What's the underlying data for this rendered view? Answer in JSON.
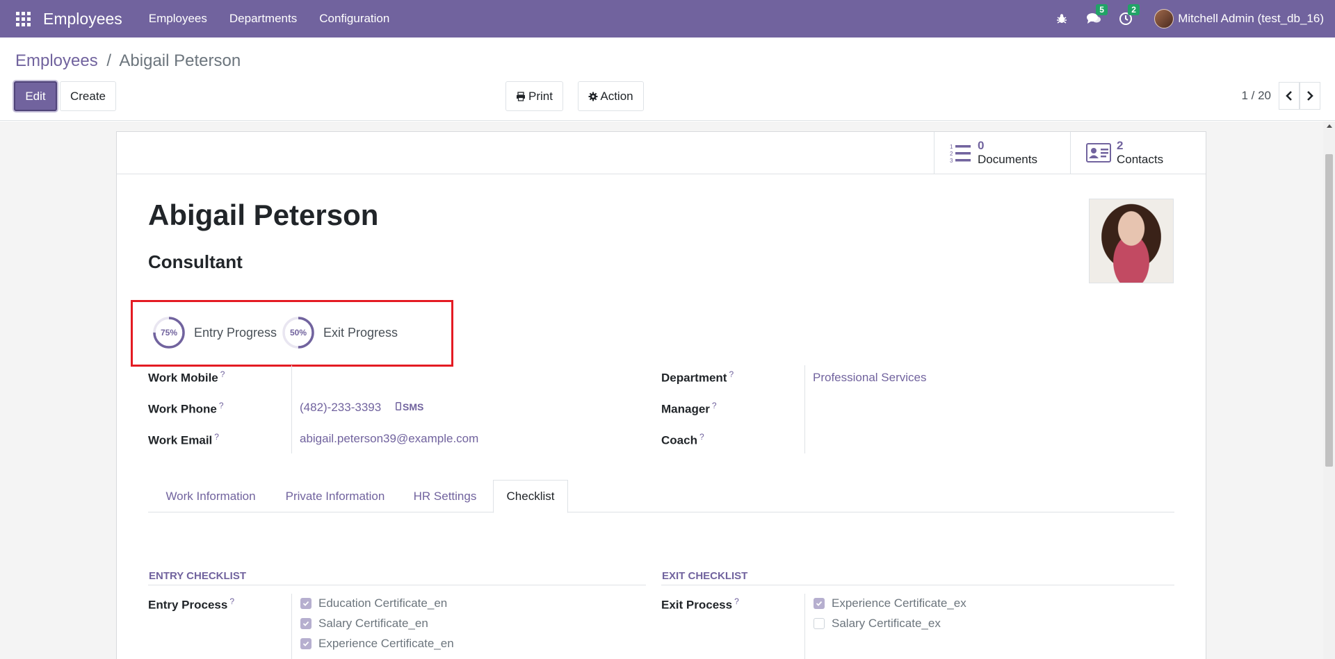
{
  "navbar": {
    "app_name": "Employees",
    "menu": [
      "Employees",
      "Departments",
      "Configuration"
    ],
    "messages_count": "5",
    "activities_count": "2",
    "user": "Mitchell Admin (test_db_16)"
  },
  "breadcrumb": {
    "parent": "Employees",
    "separator": "/",
    "current": "Abigail Peterson"
  },
  "toolbar": {
    "edit": "Edit",
    "create": "Create",
    "print": "Print",
    "action": "Action"
  },
  "pager": {
    "value": "1 / 20"
  },
  "smart_buttons": [
    {
      "count": "0",
      "label": "Documents",
      "icon": "list-numbered-icon"
    },
    {
      "count": "2",
      "label": "Contacts",
      "icon": "contact-card-icon"
    }
  ],
  "employee": {
    "name": "Abigail Peterson",
    "job_title": "Consultant"
  },
  "progress": [
    {
      "label": "Entry Progress",
      "percent_text": "75%",
      "value": 0.75
    },
    {
      "label": "Exit Progress",
      "percent_text": "50%",
      "value": 0.5
    }
  ],
  "fields_left": [
    {
      "label": "Work Mobile",
      "help": "?",
      "value": ""
    },
    {
      "label": "Work Phone",
      "help": "?",
      "value": "(482)-233-3393",
      "extra": "SMS"
    },
    {
      "label": "Work Email",
      "help": "?",
      "value": "abigail.peterson39@example.com"
    }
  ],
  "fields_right": [
    {
      "label": "Department",
      "help": "?",
      "value": "Professional Services"
    },
    {
      "label": "Manager",
      "help": "?",
      "value": ""
    },
    {
      "label": "Coach",
      "help": "?",
      "value": ""
    }
  ],
  "tabs": [
    "Work Information",
    "Private Information",
    "HR Settings",
    "Checklist"
  ],
  "active_tab": "Checklist",
  "entry_checklist": {
    "title": "ENTRY CHECKLIST",
    "field_label": "Entry Process",
    "help": "?",
    "items": [
      {
        "label": "Education Certificate_en",
        "checked": true
      },
      {
        "label": "Salary Certificate_en",
        "checked": true
      },
      {
        "label": "Experience Certificate_en",
        "checked": true
      }
    ]
  },
  "exit_checklist": {
    "title": "EXIT CHECKLIST",
    "field_label": "Exit Process",
    "help": "?",
    "items": [
      {
        "label": "Experience Certificate_ex",
        "checked": true
      },
      {
        "label": "Salary Certificate_ex",
        "checked": false
      }
    ]
  },
  "colors": {
    "brand": "#71639e",
    "highlight_border": "#e41b23",
    "badge": "#21a367"
  }
}
